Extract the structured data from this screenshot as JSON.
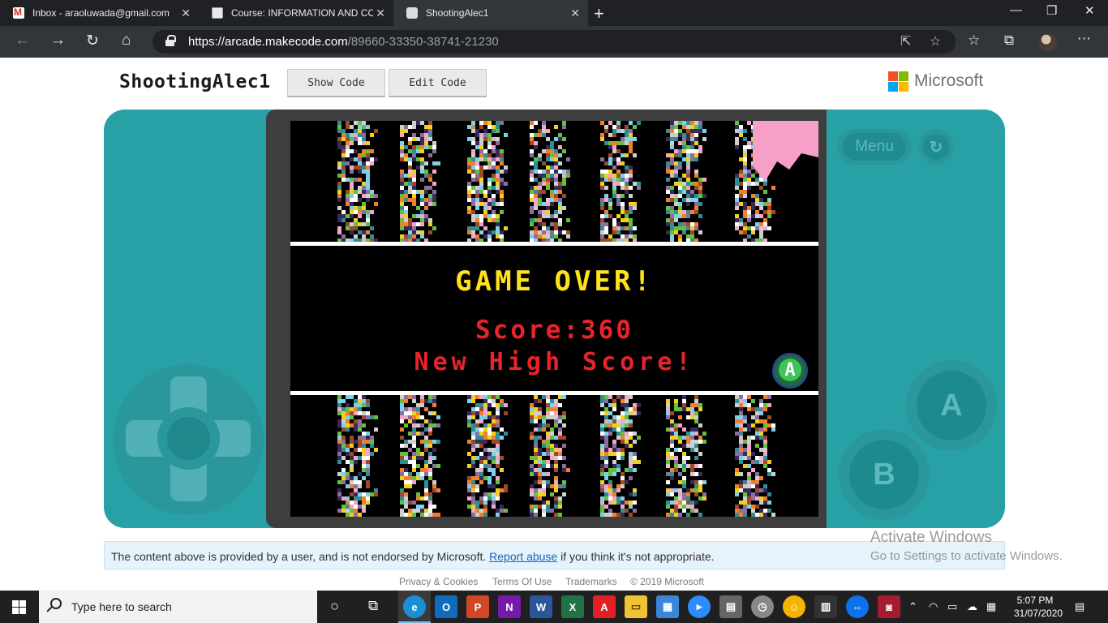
{
  "browser": {
    "tabs": [
      {
        "title": "Inbox - araoluwada@gmail.com",
        "icon": "gmail-icon"
      },
      {
        "title": "Course: INFORMATION AND CO",
        "icon": "document-icon"
      },
      {
        "title": "ShootingAlec1",
        "icon": "arcade-icon"
      }
    ],
    "url_host": "https://arcade.makecode.com",
    "url_path": "/89660-33350-38741-21230"
  },
  "page": {
    "title": "ShootingAlec1",
    "show_code": "Show Code",
    "edit_code": "Edit Code",
    "brand": "Microsoft",
    "brand_colors": [
      "#f25022",
      "#7fba00",
      "#00a4ef",
      "#ffb900"
    ]
  },
  "console": {
    "menu_label": "Menu",
    "button_a": "A",
    "button_b": "B",
    "color": "#27a1a6"
  },
  "game": {
    "title": "GAME OVER!",
    "score": "Score:360",
    "high_score": "New High Score!",
    "a_prompt": "A"
  },
  "notice": {
    "before": "The content above is provided by a user, and is not endorsed by Microsoft. ",
    "link": "Report abuse",
    "after": " if you think it's not appropriate."
  },
  "footer": {
    "privacy": "Privacy & Cookies",
    "terms": "Terms Of Use",
    "trademarks": "Trademarks",
    "copyright": "© 2019 Microsoft"
  },
  "watermark": {
    "line1": "Activate Windows",
    "line2": "Go to Settings to activate Windows."
  },
  "taskbar": {
    "search_placeholder": "Type here to search",
    "time": "5:07 PM",
    "date": "31/07/2020"
  }
}
